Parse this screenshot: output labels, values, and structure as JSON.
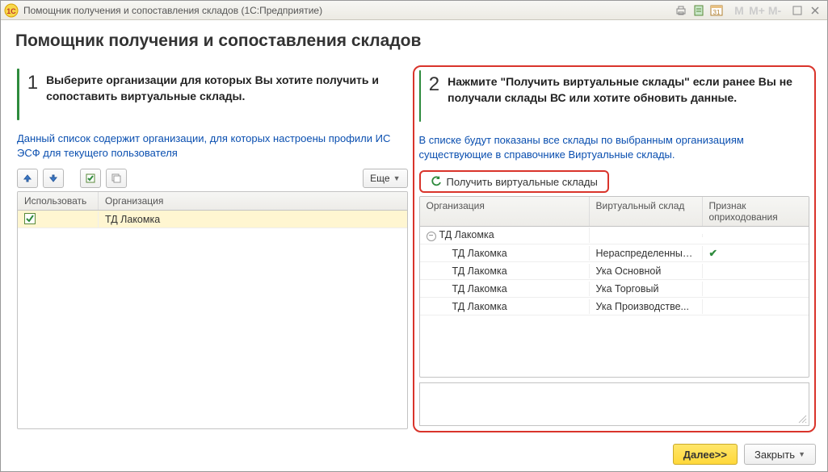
{
  "window": {
    "title": "Помощник получения и сопоставления складов  (1С:Предприятие)"
  },
  "heading": "Помощник получения и сопоставления складов",
  "left": {
    "step_num": "1",
    "step_text": "Выберите организации для которых Вы хотите получить и сопоставить виртуальные склады.",
    "hint": "Данный список содержит организации, для которых настроены профили ИС ЭСФ для текущего пользователя",
    "more_label": "Еще",
    "columns": {
      "use": "Использовать",
      "org": "Организация"
    },
    "col_widths": {
      "use": 100,
      "org_flex": 1
    },
    "rows": [
      {
        "checked": true,
        "org": "ТД Лакомка",
        "selected": true
      }
    ]
  },
  "right": {
    "step_num": "2",
    "step_text": "Нажмите \"Получить виртуальные склады\" если ранее Вы не получали склады ВС или хотите обновить данные.",
    "hint": "В списке будут показаны все склады по выбранным организациям существующие в справочнике Виртуальные склады.",
    "get_button": "Получить виртуальные склады",
    "columns": {
      "org": "Организация",
      "vs": "Виртуальный склад",
      "flag": "Признак оприходования"
    },
    "col_widths": {
      "org": 210,
      "vs": 140,
      "flag_flex": 1
    },
    "rows": [
      {
        "org": "ТД Лакомка",
        "vs": "",
        "flag": "",
        "group": true
      },
      {
        "org": "ТД Лакомка",
        "vs": "Нераспределенные...",
        "flag": "✓",
        "child": true
      },
      {
        "org": "ТД Лакомка",
        "vs": "Ука Основной",
        "flag": "",
        "child": true
      },
      {
        "org": "ТД Лакомка",
        "vs": "Ука Торговый",
        "flag": "",
        "child": true
      },
      {
        "org": "ТД Лакомка",
        "vs": "Ука Производстве...",
        "flag": "",
        "child": true
      }
    ]
  },
  "footer": {
    "next": "Далее>>",
    "close": "Закрыть"
  },
  "icons": {
    "print": "print-icon",
    "calc": "calc-icon",
    "calendar": "calendar-icon",
    "m": "M",
    "mplus": "M+",
    "mminus": "M-"
  }
}
